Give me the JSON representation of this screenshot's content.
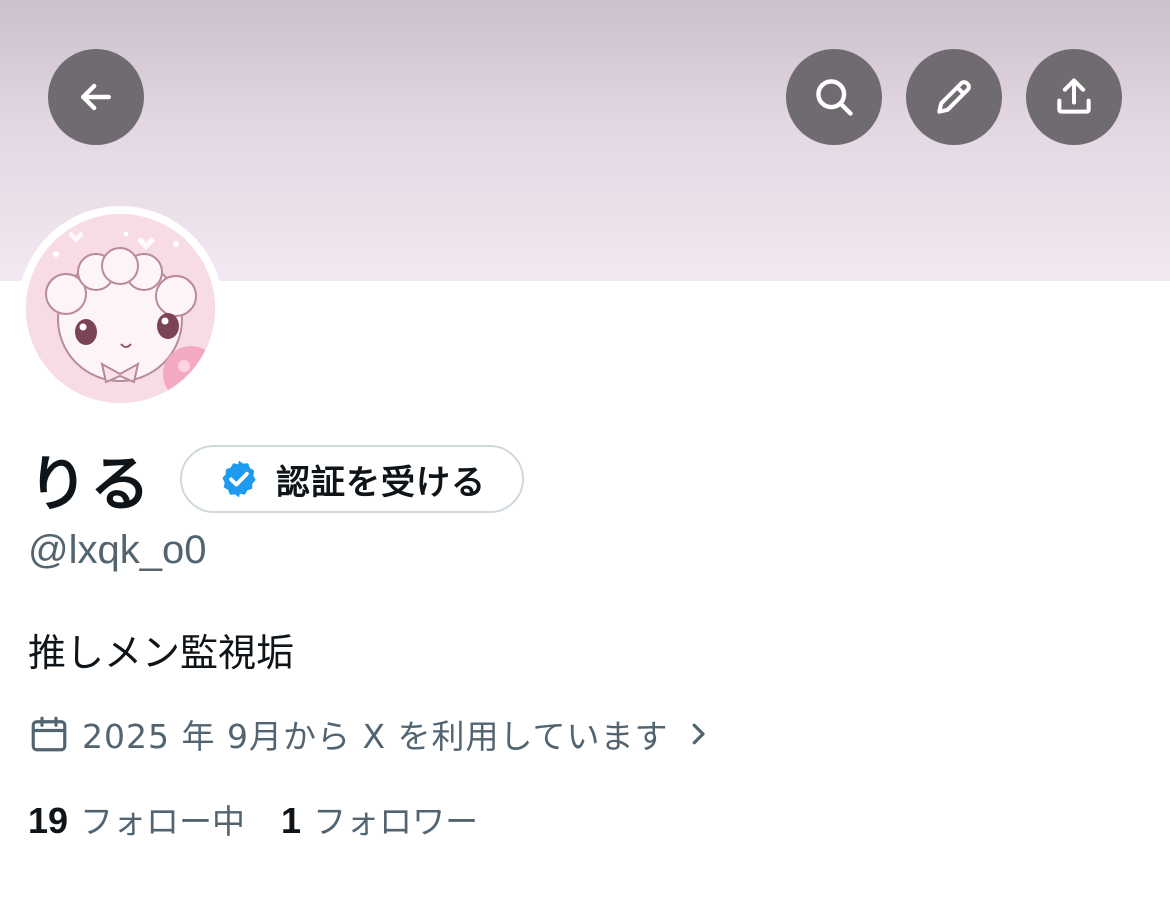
{
  "header": {
    "back_icon": "arrow-left-icon",
    "search_icon": "search-icon",
    "edit_icon": "pencil-icon",
    "share_icon": "share-upload-icon",
    "button_color": "#706b71"
  },
  "profile": {
    "display_name": "りる",
    "verify_button_label": "認証を受ける",
    "verify_icon": "verified-badge-icon",
    "verify_color": "#1d9bf0",
    "handle": "@lxqk_o0",
    "bio": "推しメン監視垢",
    "joined_icon": "calendar-icon",
    "joined_text": "2025 年 9月から X を利用しています",
    "joined_chevron": "chevron-right-icon"
  },
  "stats": {
    "following_count": "19",
    "following_label": "フォロー中",
    "followers_count": "1",
    "followers_label": "フォロワー"
  }
}
